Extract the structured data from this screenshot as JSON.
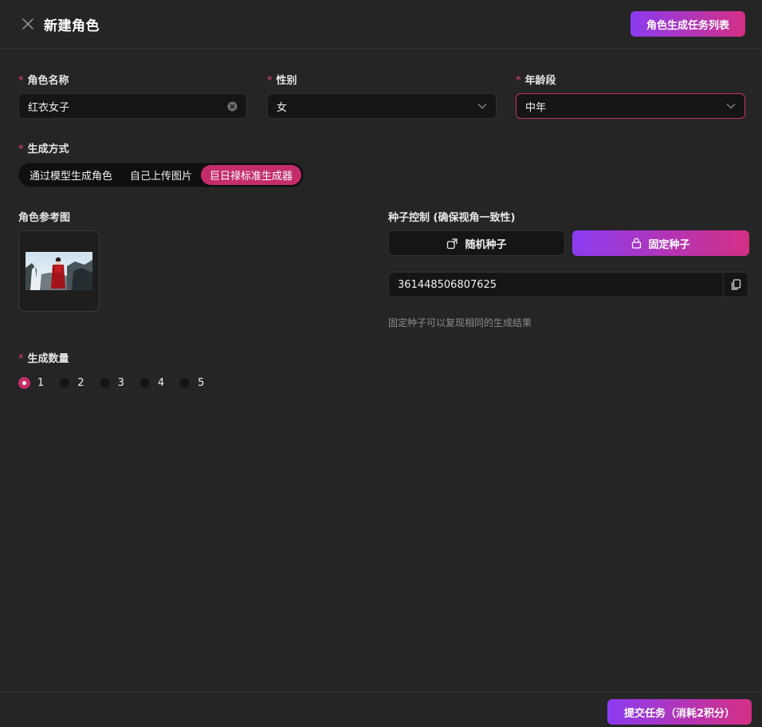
{
  "header": {
    "title": "新建角色",
    "task_list_label": "角色生成任务列表"
  },
  "form": {
    "required_mark": "*",
    "name": {
      "label": "角色名称",
      "value": "红衣女子"
    },
    "gender": {
      "label": "性别",
      "value": "女"
    },
    "age": {
      "label": "年龄段",
      "value": "中年"
    },
    "method": {
      "label": "生成方式",
      "options": [
        "通过模型生成角色",
        "自己上传图片",
        "巨日禄标准生成器"
      ],
      "selected_index": 2
    },
    "ref_image": {
      "label": "角色参考图"
    },
    "seed": {
      "label": "种子控制 (确保视角一致性)",
      "random_label": "随机种子",
      "fixed_label": "固定种子",
      "value": "361448506807625",
      "hint": "固定种子可以复现相同的生成结果"
    },
    "count": {
      "label": "生成数量",
      "options": [
        "1",
        "2",
        "3",
        "4",
        "5"
      ],
      "selected": "1"
    }
  },
  "footer": {
    "submit_label": "提交任务（消耗2积分）"
  },
  "colors": {
    "accent": "#c42d6a",
    "gradient_start": "#8b3bf0",
    "gradient_end": "#d42f84",
    "background": "#252526",
    "input_bg": "#151516"
  },
  "icons": {
    "close": "close-icon",
    "clear": "clear-circle-icon",
    "dropdown": "chevron-down-icon",
    "random": "shuffle-icon",
    "lock": "lock-icon",
    "copy": "copy-icon"
  }
}
